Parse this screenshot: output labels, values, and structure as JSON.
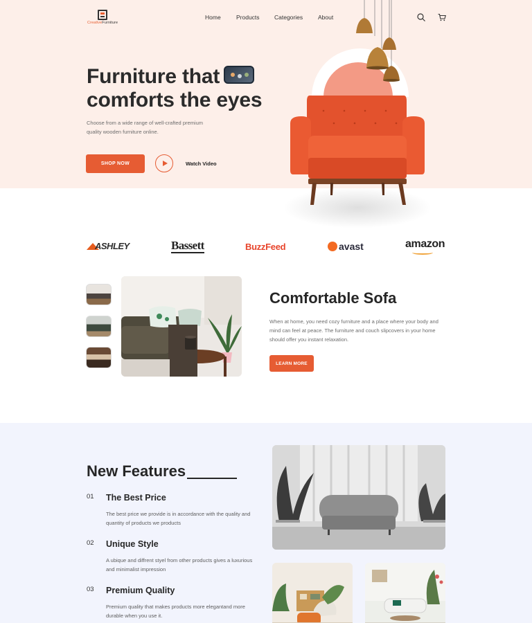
{
  "brand": {
    "name_part1": "Creative",
    "name_part2": "Furniture"
  },
  "nav": {
    "home": "Home",
    "products": "Products",
    "categories": "Categories",
    "about": "About"
  },
  "hero": {
    "title_line1": "Furniture that",
    "title_line2": "comforts the eyes",
    "description": "Choose from a wide range of well-crafted premium quality wooden furniture online.",
    "shop_button": "SHOP NOW",
    "watch_label": "Watch Video"
  },
  "partners": [
    "ASHLEY",
    "Bassett",
    "BuzzFeed",
    "avast",
    "amazon"
  ],
  "sofa": {
    "title": "Comfortable Sofa",
    "description": "When at home, you need cozy furniture and a place where your body and mind can feel at peace. The furniture and couch slipcovers in your home should offer you instant relaxation.",
    "button": "LEARN MORE"
  },
  "features": {
    "title": "New Features",
    "items": [
      {
        "num": "01",
        "name": "The Best Price",
        "desc": "The best price we provide is in accordance with the quality and quantity of products we products"
      },
      {
        "num": "02",
        "name": "Unique Style",
        "desc": "A ubique and diffrent styel from other products gives a luxurious and minimalist impression"
      },
      {
        "num": "03",
        "name": "Premium Quality",
        "desc": "Premium quality that makes products more elegantand more durable when you use it."
      }
    ]
  },
  "colors": {
    "accent": "#e65c33",
    "hero_bg": "#fdefe9",
    "features_bg": "#f2f4fd",
    "chair": "#e3522d"
  },
  "icons": [
    "search-icon",
    "cart-icon",
    "play-icon"
  ]
}
